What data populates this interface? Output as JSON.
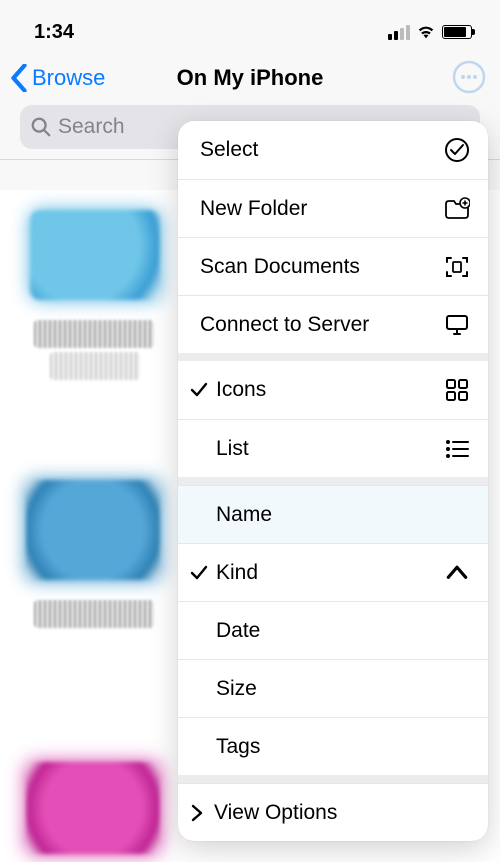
{
  "status": {
    "time": "1:34"
  },
  "nav": {
    "back_label": "Browse",
    "title": "On My iPhone"
  },
  "search": {
    "placeholder": "Search"
  },
  "menu": {
    "select": "Select",
    "new_folder": "New Folder",
    "scan_documents": "Scan Documents",
    "connect_server": "Connect to Server",
    "icons": "Icons",
    "list": "List",
    "name": "Name",
    "kind": "Kind",
    "date": "Date",
    "size": "Size",
    "tags": "Tags",
    "view_options": "View Options"
  }
}
